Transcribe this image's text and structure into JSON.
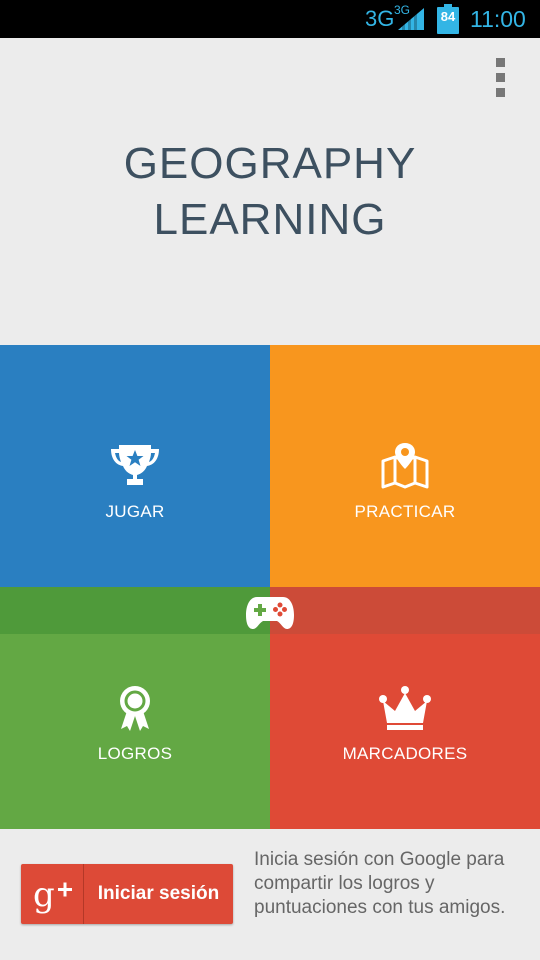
{
  "status_bar": {
    "network": "3G",
    "network_sup": "3G",
    "battery": "84",
    "time": "11:00"
  },
  "app": {
    "title_line1": "GEOGRAPHY",
    "title_line2": "LEARNING"
  },
  "tiles": {
    "jugar": {
      "label": "JUGAR",
      "icon": "trophy-icon",
      "color": "#2a7fc1"
    },
    "practicar": {
      "label": "PRACTICAR",
      "icon": "map-icon",
      "color": "#f8961e"
    },
    "logros": {
      "label": "LOGROS",
      "icon": "award-ribbon-icon",
      "color": "#63a844"
    },
    "marcadores": {
      "label": "MARCADORES",
      "icon": "crown-icon",
      "color": "#df4a36"
    }
  },
  "center_icon": "gamepad-icon",
  "signin": {
    "button_label": "Iniciar sesión",
    "icon_text": "g+",
    "description": "Inicia sesión con Google para compartir los logros y puntuaciones con tus amigos."
  },
  "menu": {
    "icon": "overflow-menu-icon"
  }
}
